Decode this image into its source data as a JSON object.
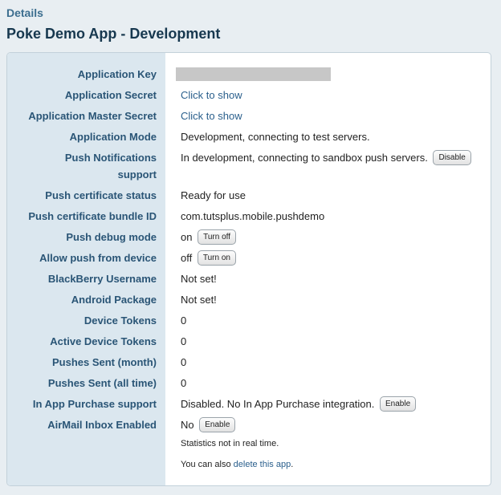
{
  "header": {
    "breadcrumb": "Details",
    "title": "Poke Demo App - Development"
  },
  "rows": [
    {
      "label": "Application Key",
      "value": ""
    },
    {
      "label": "Application Secret",
      "value": "Click to show"
    },
    {
      "label": "Application Master Secret",
      "value": "Click to show"
    },
    {
      "label": "Application Mode",
      "value": "Development, connecting to test servers."
    },
    {
      "label_line1": "Push Notifications",
      "label_line2": "support",
      "value": "In development, connecting to sandbox push servers.",
      "button": "Disable"
    },
    {
      "label": "Push certificate status",
      "value": "Ready for use"
    },
    {
      "label": "Push certificate bundle ID",
      "value": "com.tutsplus.mobile.pushdemo"
    },
    {
      "label": "Push debug mode",
      "value": "on",
      "button": "Turn off"
    },
    {
      "label": "Allow push from device",
      "value": "off",
      "button": "Turn on"
    },
    {
      "label": "BlackBerry Username",
      "value": "Not set!"
    },
    {
      "label": "Android Package",
      "value": "Not set!"
    },
    {
      "label": "Device Tokens",
      "value": "0"
    },
    {
      "label": "Active Device Tokens",
      "value": "0"
    },
    {
      "label": "Pushes Sent (month)",
      "value": "0"
    },
    {
      "label": "Pushes Sent (all time)",
      "value": "0"
    },
    {
      "label": "In App Purchase support",
      "value": "Disabled. No In App Purchase integration.",
      "button": "Enable"
    },
    {
      "label": "AirMail Inbox Enabled",
      "value": "No",
      "button": "Enable"
    }
  ],
  "footer": {
    "stats_note": "Statistics not in real time.",
    "delete_prefix": "You can also ",
    "delete_link": "delete this app",
    "delete_suffix": "."
  }
}
